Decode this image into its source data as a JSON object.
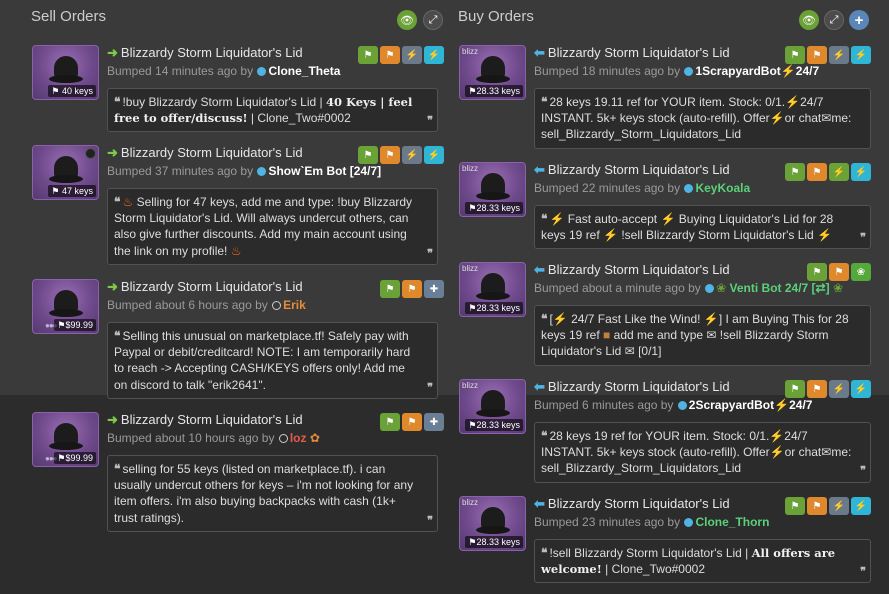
{
  "sell": {
    "title": "Sell Orders",
    "listings": [
      {
        "name": "Blizzardy Storm Liquidator's Lid",
        "price": "40 keys",
        "bumped": "Bumped 14 minutes ago by",
        "user": "Clone_Theta",
        "comment_prefix": "!buy Blizzardy Storm Liquidator's Lid | ",
        "comment_bold": "40 Keys | feel free to offer/discuss!",
        "comment_suffix": " | Clone_Two#0002"
      },
      {
        "name": "Blizzardy Storm Liquidator's Lid",
        "price": "47 keys",
        "bumped": "Bumped 37 minutes ago by",
        "user": "Show`Em Bot [24/7]",
        "comment": "Selling for 47 keys, add me and type: !buy Blizzardy Storm Liquidator's Lid. Will always undercut others, can also give further discounts. Add my main account using the link on my profile!"
      },
      {
        "name": "Blizzardy Storm Liquidator's Lid",
        "price": "$99.99",
        "bumped": "Bumped about 6 hours ago by",
        "user": "Erik",
        "comment": "Selling this unusual on marketplace.tf! Safely pay with Paypal or debit/creditcard! NOTE: I am temporarily hard to reach -> Accepting CASH/KEYS offers only! Add me on discord to talk \"erik2641\"."
      },
      {
        "name": "Blizzardy Storm Liquidator's Lid",
        "price": "$99.99",
        "bumped": "Bumped about 10 hours ago by",
        "user": "loz",
        "comment": "selling for 55 keys (listed on marketplace.tf). i can usually undercut others for keys – i'm not looking for any item offers. i'm also buying backpacks with cash (1k+ trust ratings)."
      }
    ]
  },
  "buy": {
    "title": "Buy Orders",
    "listings": [
      {
        "name": "Blizzardy Storm Liquidator's Lid",
        "price": "28.33 keys",
        "tag": "blizz",
        "bumped": "Bumped 18 minutes ago by",
        "user": "1ScrapyardBot",
        "user_suffix": "24/7",
        "comment_a": "28 keys 19.11 ref for YOUR item. Stock: 0/1.",
        "comment_b": "24/7 INSTANT. 5k+ keys stock (auto-refill). Offer",
        "comment_c": "or chat",
        "comment_d": "me: sell_Blizzardy_Storm_Liquidators_Lid"
      },
      {
        "name": "Blizzardy Storm Liquidator's Lid",
        "price": "28.33 keys",
        "tag": "blizz",
        "bumped": "Bumped 22 minutes ago by",
        "user": "KeyKoala",
        "comment_a": "Fast auto-accept",
        "comment_b": "Buying Liquidator's Lid for 28 keys 19 ref",
        "comment_c": "!sell Blizzardy Storm Liquidator's Lid"
      },
      {
        "name": "Blizzardy Storm Liquidator's Lid",
        "price": "28.33 keys",
        "tag": "blizz",
        "bumped": "Bumped about a minute ago by",
        "user": "Venti Bot 24/7 [⇄]",
        "comment_a": "[",
        "comment_b": "24/7 Fast Like the Wind!",
        "comment_c": "] I am Buying This for 28 keys 19 ref",
        "comment_d": "add me and type",
        "comment_e": "!sell Blizzardy Storm Liquidator's Lid",
        "comment_f": "[0/1]"
      },
      {
        "name": "Blizzardy Storm Liquidator's Lid",
        "price": "28.33 keys",
        "tag": "blizz",
        "bumped": "Bumped 6 minutes ago by",
        "user": "2ScrapyardBot",
        "user_suffix": "24/7",
        "comment_a": "28 keys 19 ref for YOUR item. Stock: 0/1.",
        "comment_b": "24/7 INSTANT. 5k+ keys stock (auto-refill). Offer",
        "comment_c": "or chat",
        "comment_d": "me: sell_Blizzardy_Storm_Liquidators_Lid"
      },
      {
        "name": "Blizzardy Storm Liquidator's Lid",
        "price": "28.33 keys",
        "tag": "blizz",
        "bumped": "Bumped 23 minutes ago by",
        "user": "Clone_Thorn",
        "comment_prefix": "!sell Blizzardy Storm Liquidator's Lid | ",
        "comment_bold": "All offers are welcome!",
        "comment_suffix": " | Clone_Two#0002"
      }
    ]
  },
  "colors": {
    "accent_green": "#6aa238",
    "accent_orange": "#e0892c",
    "accent_blue": "#2fb5d6",
    "buy_arrow": "#4fb3e3",
    "sell_arrow": "#7ec84a"
  }
}
